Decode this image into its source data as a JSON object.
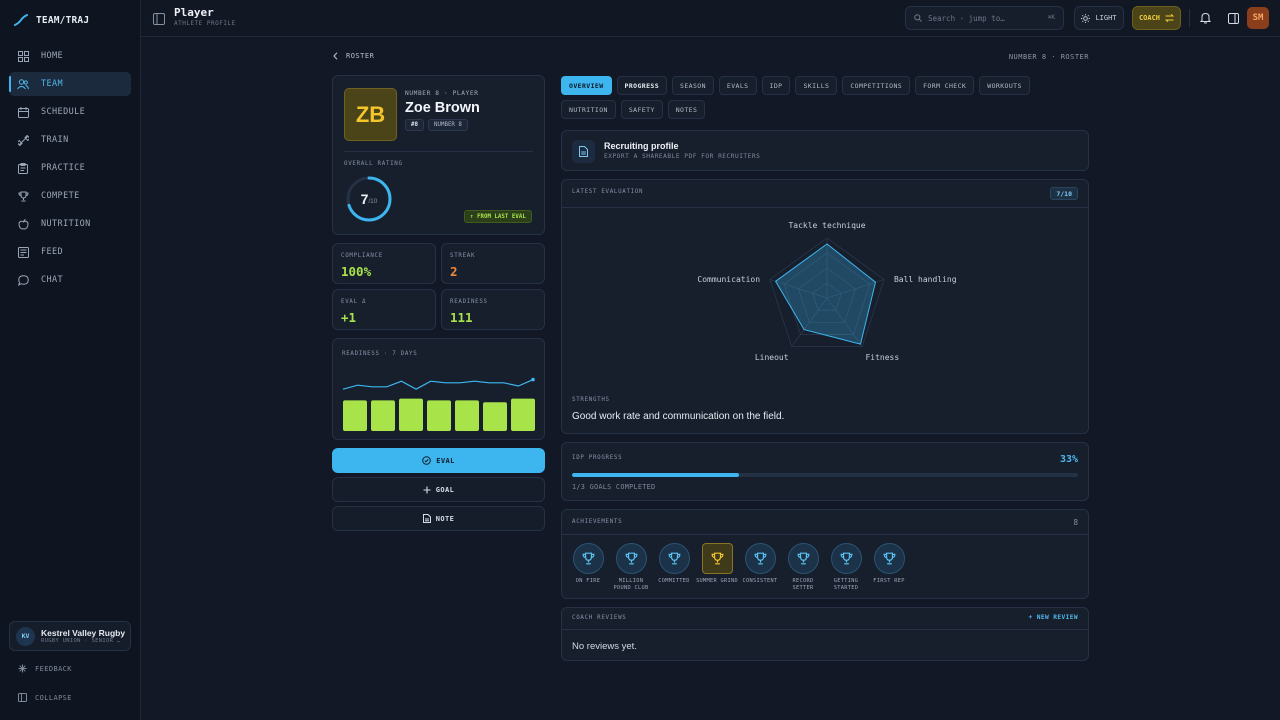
{
  "brand": {
    "name": "TEAM/TRAJ"
  },
  "sidebar": {
    "items": [
      {
        "label": "HOME",
        "icon": "grid-icon"
      },
      {
        "label": "TEAM",
        "icon": "users-icon",
        "active": true
      },
      {
        "label": "SCHEDULE",
        "icon": "calendar-icon"
      },
      {
        "label": "TRAIN",
        "icon": "dumbbell-icon"
      },
      {
        "label": "PRACTICE",
        "icon": "clipboard-icon"
      },
      {
        "label": "COMPETE",
        "icon": "trophy-icon"
      },
      {
        "label": "NUTRITION",
        "icon": "apple-icon"
      },
      {
        "label": "FEED",
        "icon": "newspaper-icon"
      },
      {
        "label": "CHAT",
        "icon": "chat-icon"
      }
    ],
    "org": {
      "initials": "KV",
      "name": "Kestrel Valley Rugby",
      "sub": "RUGBY UNION · SENIOR …"
    },
    "feedback": "FEEDBACK",
    "collapse": "COLLAPSE"
  },
  "header": {
    "title": "Player",
    "subtitle": "ATHLETE PROFILE",
    "search_placeholder": "Search · jump to…",
    "search_kbd": "⌘K",
    "theme_label": "LIGHT",
    "role_label": "COACH",
    "user_initials": "SM"
  },
  "crumbs": {
    "back": "ROSTER",
    "right": "NUMBER 8 · ROSTER"
  },
  "player": {
    "initials": "ZB",
    "kicker": "NUMBER 8 · PLAYER",
    "name": "Zoe Brown",
    "number_tag": "#8",
    "position_tag": "NUMBER 8",
    "rating_label": "OVERALL RATING",
    "rating": 7,
    "rating_max": "/10",
    "delta": "↑ FROM LAST EVAL"
  },
  "stats": [
    {
      "label": "COMPLIANCE",
      "value": "100%"
    },
    {
      "label": "STREAK",
      "value": "2"
    },
    {
      "label": "EVAL Δ",
      "value": "+1"
    },
    {
      "label": "READINESS",
      "value": "111"
    }
  ],
  "readiness": {
    "label": "READINESS · 7 DAYS",
    "bars": [
      0.85,
      0.85,
      0.9,
      0.85,
      0.85,
      0.8,
      0.9
    ],
    "line": [
      0.3,
      0.55,
      0.45,
      0.45,
      0.8,
      0.3,
      0.8,
      0.7,
      0.7,
      0.8,
      0.7,
      0.7,
      0.5,
      0.9
    ]
  },
  "actions": {
    "eval": "EVAL",
    "goal": "GOAL",
    "note": "NOTE"
  },
  "tabs": [
    "OVERVIEW",
    "PROGRESS",
    "SEASON",
    "EVALS",
    "IDP",
    "SKILLS",
    "COMPETITIONS",
    "FORM CHECK",
    "WORKOUTS",
    "NUTRITION",
    "SAFETY",
    "NOTES"
  ],
  "recruit": {
    "title": "Recruiting profile",
    "subtitle": "EXPORT A SHAREABLE PDF FOR RECRUITERS"
  },
  "evaluation": {
    "label": "LATEST EVALUATION",
    "score": "7/10",
    "axes": [
      "Tackle technique",
      "Ball handling",
      "Fitness",
      "Lineout",
      "Communication"
    ],
    "values": [
      0.9,
      0.85,
      0.95,
      0.65,
      0.9
    ],
    "strengths_label": "STRENGTHS",
    "strengths": "Good work rate and communication on the field."
  },
  "idp": {
    "label": "IDP PROGRESS",
    "percent_text": "33%",
    "percent": 33,
    "sub": "1/3 GOALS COMPLETED"
  },
  "achievements": {
    "label": "ACHIEVEMENTS",
    "count": "8",
    "items": [
      {
        "label": "ON FIRE",
        "gold": false
      },
      {
        "label": "MILLION POUND CLUB",
        "gold": false
      },
      {
        "label": "COMMITTED",
        "gold": false
      },
      {
        "label": "SUMMER GRIND",
        "gold": true
      },
      {
        "label": "CONSISTENT",
        "gold": false
      },
      {
        "label": "RECORD SETTER",
        "gold": false
      },
      {
        "label": "GETTING STARTED",
        "gold": false
      },
      {
        "label": "FIRST REP",
        "gold": false
      }
    ]
  },
  "reviews": {
    "label": "COACH REVIEWS",
    "new_label": "NEW REVIEW",
    "empty": "No reviews yet."
  },
  "colors": {
    "accent": "#3db6f0",
    "green": "#a8e34a",
    "gold": "#f4c52a",
    "orange": "#f08a3a"
  }
}
